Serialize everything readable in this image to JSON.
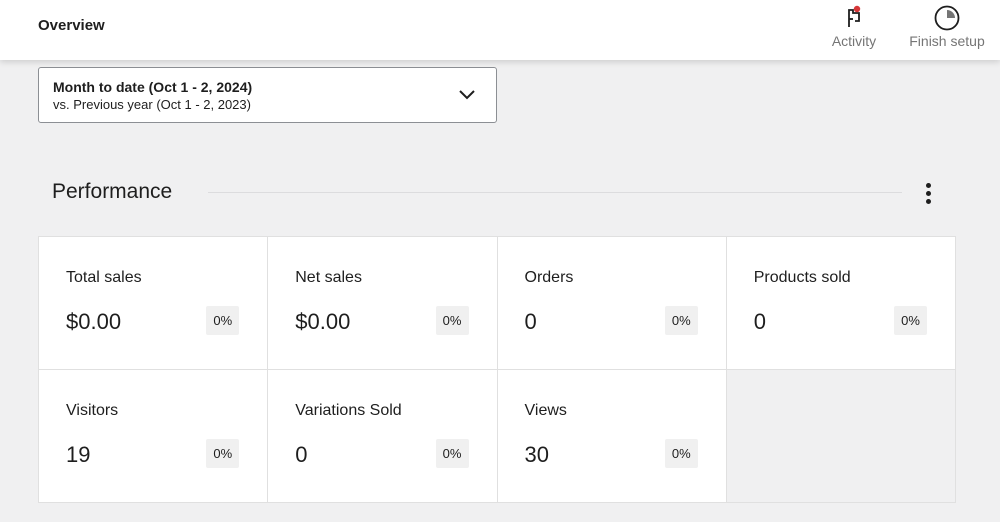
{
  "header": {
    "title": "Overview",
    "actions": [
      {
        "label": "Activity",
        "icon": "flag-icon",
        "has_notification": true,
        "notification_color": "#d63638"
      },
      {
        "label": "Finish setup",
        "icon": "progress-circle-icon"
      }
    ]
  },
  "date_range": {
    "primary": "Month to date (Oct 1 - 2, 2024)",
    "comparison": "vs. Previous year (Oct 1 - 2, 2023)"
  },
  "performance": {
    "title": "Performance",
    "tiles": [
      {
        "label": "Total sales",
        "value": "$0.00",
        "delta": "0%"
      },
      {
        "label": "Net sales",
        "value": "$0.00",
        "delta": "0%"
      },
      {
        "label": "Orders",
        "value": "0",
        "delta": "0%"
      },
      {
        "label": "Products sold",
        "value": "0",
        "delta": "0%"
      },
      {
        "label": "Visitors",
        "value": "19",
        "delta": "0%"
      },
      {
        "label": "Variations Sold",
        "value": "0",
        "delta": "0%"
      },
      {
        "label": "Views",
        "value": "30",
        "delta": "0%"
      }
    ]
  }
}
